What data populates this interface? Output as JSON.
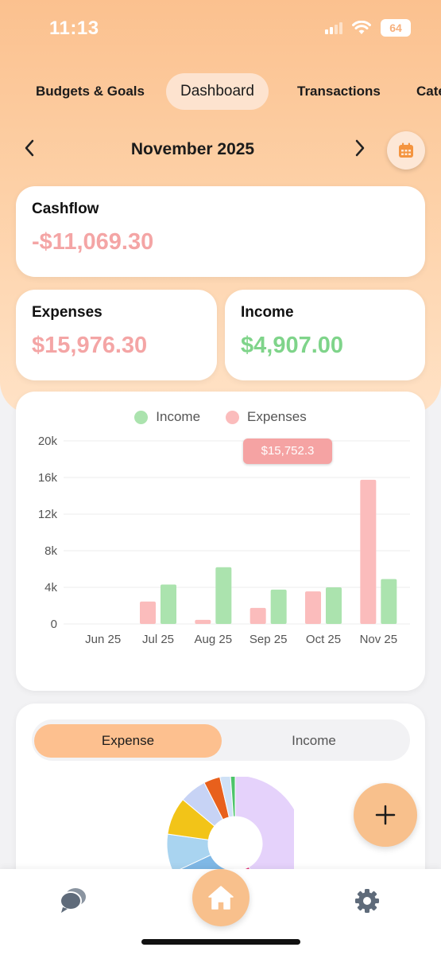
{
  "status_bar": {
    "time": "11:13",
    "battery": "64"
  },
  "tabs": [
    {
      "label": "Budgets & Goals",
      "active": false
    },
    {
      "label": "Dashboard",
      "active": true
    },
    {
      "label": "Transactions",
      "active": false
    },
    {
      "label": "Cate",
      "active": false
    }
  ],
  "month_nav": {
    "title": "November 2025",
    "prev_icon": "chevron-left-icon",
    "next_icon": "chevron-right-icon",
    "calendar_icon": "calendar-icon"
  },
  "cashflow": {
    "label": "Cashflow",
    "value": "-$11,069.30"
  },
  "expenses": {
    "label": "Expenses",
    "value": "$15,976.30"
  },
  "income": {
    "label": "Income",
    "value": "$4,907.00"
  },
  "colors": {
    "income": "#abe3ae",
    "expenses": "#fbbcbc",
    "accent": "#fdc08f",
    "negative": "#f4a5a5",
    "positive": "#7fd48a"
  },
  "chart_data": {
    "type": "bar",
    "categories": [
      "Jun 25",
      "Jul 25",
      "Aug 25",
      "Sep 25",
      "Oct 25",
      "Nov 25"
    ],
    "series": [
      {
        "name": "Income",
        "values": [
          0,
          4300,
          6200,
          3750,
          4000,
          4907
        ]
      },
      {
        "name": "Expenses",
        "values": [
          0,
          2450,
          450,
          1750,
          3550,
          15752.3
        ]
      }
    ],
    "y_ticks": [
      "0",
      "4k",
      "8k",
      "12k",
      "16k",
      "20k"
    ],
    "ylim": [
      0,
      20000
    ],
    "legend_position": "top-center",
    "tooltip": "$15,752.3",
    "grid": true
  },
  "breakdown": {
    "segment": {
      "expense_label": "Expense",
      "income_label": "Income",
      "selected": "Expense"
    },
    "donut_colors": [
      "#e5d2fb",
      "#e0337a",
      "#7fb8e6",
      "#a9d4f0",
      "#f2c418",
      "#c7d3f5",
      "#e8601c",
      "#cfe1f6",
      "#4cc46a"
    ]
  },
  "fab": {
    "icon": "plus-icon"
  },
  "bottom_nav": {
    "chat_icon": "chat-bubble-icon",
    "home_icon": "home-icon",
    "settings_icon": "gear-icon"
  }
}
